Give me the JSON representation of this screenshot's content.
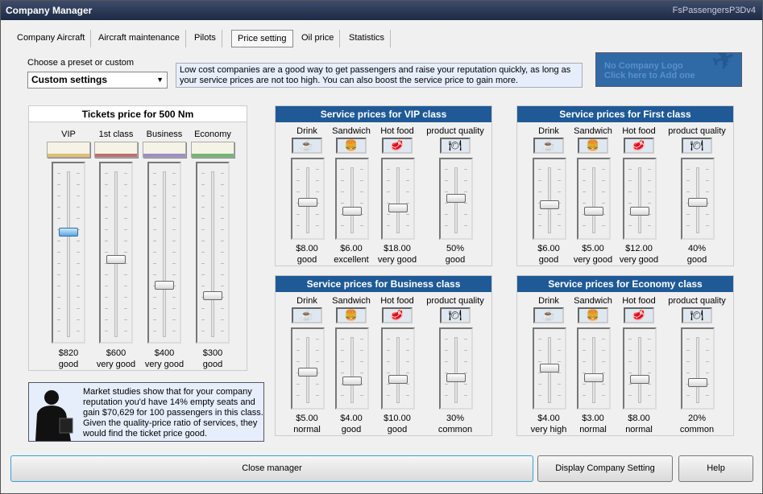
{
  "window": {
    "title": "Company Manager",
    "brand": "FsPassengersP3Dv4"
  },
  "tabs": [
    {
      "label": "Company Aircraft"
    },
    {
      "label": "Aircraft maintenance"
    },
    {
      "label": "Pilots"
    },
    {
      "label": "Price setting",
      "active": true
    },
    {
      "label": "Oil price"
    },
    {
      "label": "Statistics"
    }
  ],
  "preset": {
    "label": "Choose a preset or custom",
    "value": "Custom settings"
  },
  "info_text": "Low cost companies are a good way to get passengers and raise your reputation quickly, as long as your service prices are not too high. You can also boost the service price to gain more.",
  "logo": {
    "line1": "No Company Logo",
    "line2": "Click here to Add one"
  },
  "tickets": {
    "title": "Tickets price for 500 Nm",
    "classes": [
      {
        "label": "VIP",
        "price": "$820",
        "rating": "good",
        "level": 0.63,
        "color": "#e0c070"
      },
      {
        "label": "1st class",
        "price": "$600",
        "rating": "very good",
        "level": 0.46,
        "color": "#c07070"
      },
      {
        "label": "Business",
        "price": "$400",
        "rating": "very good",
        "level": 0.3,
        "color": "#a08cc8"
      },
      {
        "label": "Economy",
        "price": "$300",
        "rating": "good",
        "level": 0.23,
        "color": "#70b870"
      }
    ]
  },
  "service_columns": [
    "Drink",
    "Sandwich",
    "Hot food",
    "product quality"
  ],
  "service_panels": [
    {
      "title": "Service prices for VIP class",
      "items": [
        {
          "value": "$8.00",
          "rating": "good",
          "level": 0.44
        },
        {
          "value": "$6.00",
          "rating": "excellent",
          "level": 0.3
        },
        {
          "value": "$18.00",
          "rating": "very good",
          "level": 0.35
        },
        {
          "value": "50%",
          "rating": "good",
          "level": 0.52
        }
      ]
    },
    {
      "title": "Service prices for First class",
      "items": [
        {
          "value": "$6.00",
          "rating": "good",
          "level": 0.41
        },
        {
          "value": "$5.00",
          "rating": "very good",
          "level": 0.3
        },
        {
          "value": "$12.00",
          "rating": "very good",
          "level": 0.3
        },
        {
          "value": "40%",
          "rating": "good",
          "level": 0.44
        }
      ]
    },
    {
      "title": "Service prices for Business class",
      "items": [
        {
          "value": "$5.00",
          "rating": "normal",
          "level": 0.45
        },
        {
          "value": "$4.00",
          "rating": "good",
          "level": 0.3
        },
        {
          "value": "$10.00",
          "rating": "good",
          "level": 0.33
        },
        {
          "value": "30%",
          "rating": "common",
          "level": 0.35
        }
      ]
    },
    {
      "title": "Service prices for Economy class",
      "items": [
        {
          "value": "$4.00",
          "rating": "very high",
          "level": 0.52
        },
        {
          "value": "$3.00",
          "rating": "normal",
          "level": 0.35
        },
        {
          "value": "$8.00",
          "rating": "normal",
          "level": 0.33
        },
        {
          "value": "20%",
          "rating": "common",
          "level": 0.27
        }
      ]
    }
  ],
  "market_text": "Market studies show that for your company reputation you'd have 14% empty seats and gain $70,629 for 100 passengers in this class. Given the quality-price ratio of services, they would find the ticket price good.",
  "buttons": {
    "close": "Close manager",
    "display": "Display Company Setting",
    "help": "Help"
  }
}
